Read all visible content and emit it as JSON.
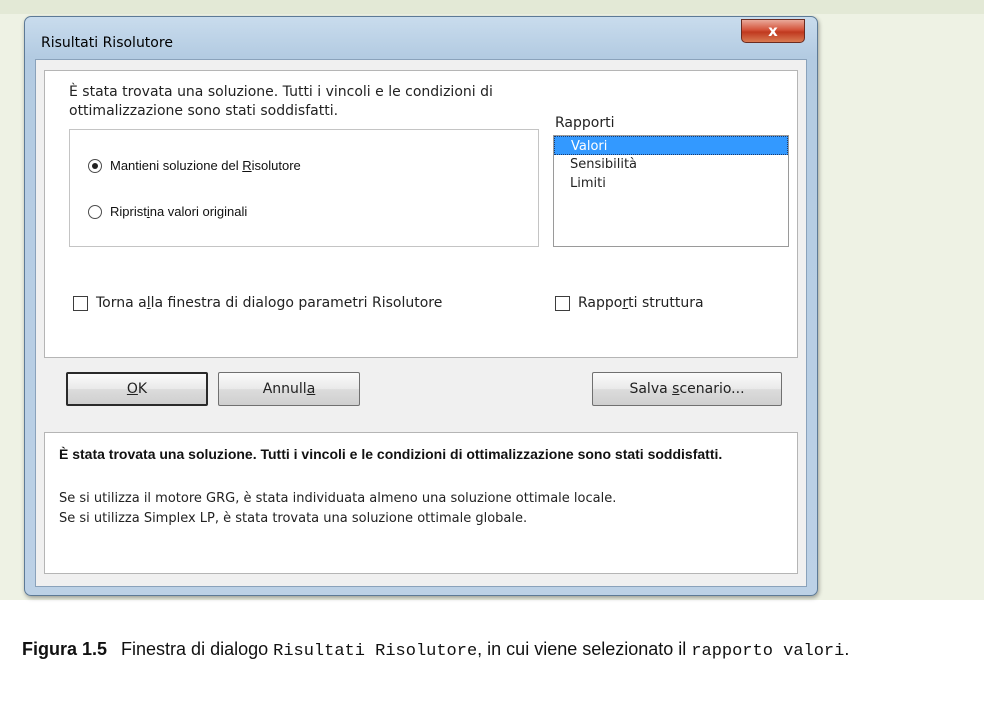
{
  "window": {
    "title": "Risultati Risolutore",
    "close_glyph": "x"
  },
  "main": {
    "message": "È stata trovata una soluzione. Tutti i vincoli e le condizioni di ottimalizzazione sono stati soddisfatti.",
    "options": [
      {
        "pre": "Mantieni soluzione del ",
        "key": "R",
        "post": "isolutore",
        "selected": true
      },
      {
        "pre": "Riprist",
        "key": "i",
        "post": "na valori originali",
        "selected": false
      }
    ],
    "reports": {
      "label": "Rapporti",
      "items": [
        "Valori",
        "Sensibilità",
        "Limiti"
      ],
      "selected_index": 0
    },
    "checkbox_return": {
      "pre": "Torna a",
      "key": "l",
      "post": "la finestra di dialogo parametri Risolutore",
      "checked": false
    },
    "checkbox_outline": {
      "pre": "Rappo",
      "key": "r",
      "post": "ti struttura",
      "checked": false
    }
  },
  "buttons": {
    "ok": {
      "pre": "",
      "key": "O",
      "post": "K"
    },
    "cancel": {
      "pre": "Annull",
      "key": "a",
      "post": ""
    },
    "save": {
      "pre": "Salva ",
      "key": "s",
      "post": "cenario..."
    }
  },
  "info": {
    "bold": "È stata trovata una soluzione. Tutti i vincoli e le condizioni di ottimalizzazione sono stati soddisfatti.",
    "line1": "Se si utilizza il motore GRG, è stata individuata almeno una soluzione ottimale locale.",
    "line2": "Se si utilizza Simplex LP, è stata trovata una soluzione ottimale globale."
  },
  "caption": {
    "label": "Figura 1.5",
    "text1": "Finestra di dialogo ",
    "mono1": "Risultati Risolutore",
    "text2": ", in cui viene selezionato il ",
    "mono2": "rapporto valori",
    "text3": "."
  }
}
